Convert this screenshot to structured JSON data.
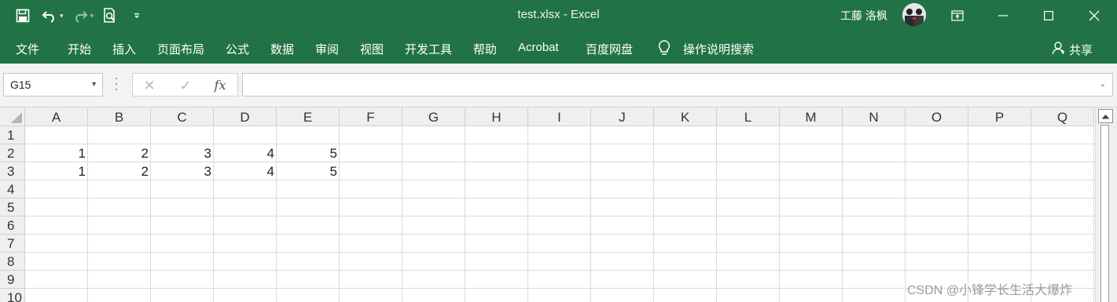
{
  "window": {
    "title": "test.xlsx  -  Excel",
    "user_name": "工藤 洛枫",
    "accent_color": "#217346"
  },
  "quick_access": {
    "icons": [
      "save-icon",
      "undo-icon",
      "redo-icon",
      "print-preview-icon",
      "customize-qat-icon"
    ]
  },
  "ribbon": {
    "tabs": [
      "文件",
      "开始",
      "插入",
      "页面布局",
      "公式",
      "数据",
      "审阅",
      "视图",
      "开发工具",
      "帮助",
      "Acrobat",
      "百度网盘"
    ],
    "tell_me": "操作说明搜索",
    "share": "共享"
  },
  "formula_bar": {
    "name_box": "G15",
    "fx_label": "fx",
    "formula": ""
  },
  "sheet": {
    "columns": [
      "A",
      "B",
      "C",
      "D",
      "E",
      "F",
      "G",
      "H",
      "I",
      "J",
      "K",
      "L",
      "M",
      "N",
      "O",
      "P",
      "Q"
    ],
    "rows": [
      "1",
      "2",
      "3",
      "4",
      "5",
      "6",
      "7",
      "8",
      "9",
      "10"
    ],
    "cells": [
      [
        "",
        "",
        "",
        "",
        ""
      ],
      [
        "1",
        "2",
        "3",
        "4",
        "5"
      ],
      [
        "1",
        "2",
        "3",
        "4",
        "5"
      ]
    ]
  },
  "watermark": "CSDN @小锋学长生活大爆炸"
}
